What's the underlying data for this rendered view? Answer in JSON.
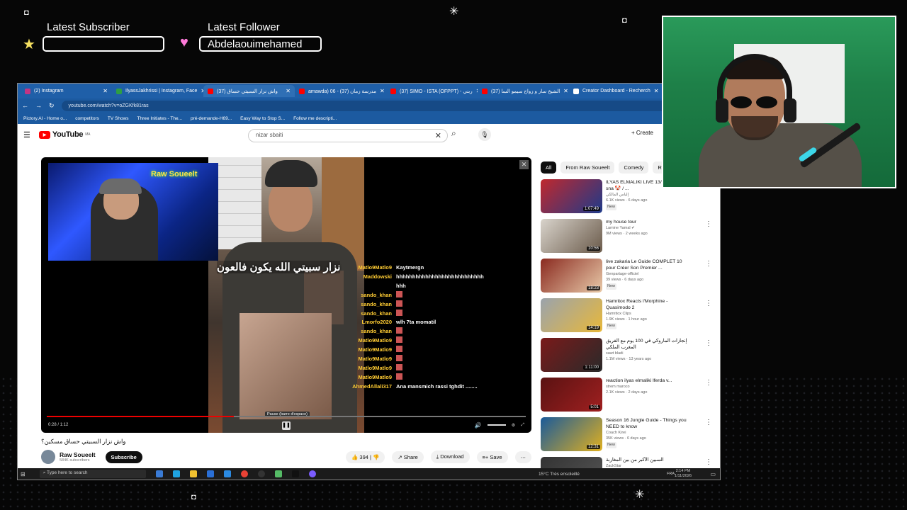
{
  "overlay": {
    "subscriber_label": "Latest Subscriber",
    "subscriber_value": "",
    "follower_label": "Latest Follower",
    "follower_value": "Abdelaouimehamed"
  },
  "browser": {
    "tabs": [
      {
        "label": "(2) Instagram",
        "color": "#c13584"
      },
      {
        "label": "IlyassJakhrissi | Instagram, Face",
        "color": "#2e9e44"
      },
      {
        "label": "واش نزار السبيتي حساق (37)",
        "color": "#ff0000"
      },
      {
        "label": "amawda) 06 - مدرسة زمان (37)",
        "color": "#ff0000"
      },
      {
        "label": "(37) SIMO - ISTA (OFPPT) - ربني",
        "color": "#ff0000"
      },
      {
        "label": "(37) الشيخ سار و زواج سيمو السا",
        "color": "#ff0000"
      },
      {
        "label": "Creator Dashboard - Recherch",
        "color": "#ffffff"
      }
    ],
    "url": "youtube.com/watch?v=oZGKfk81ras",
    "bookmarks": [
      "Pictory.AI - Home o...",
      "competitors",
      "TV Shows",
      "Three Initiates - The...",
      "pré-demande-H69...",
      "Easy Way to Stop S...",
      "Follow me descripti..."
    ]
  },
  "youtube": {
    "logo": "YouTube",
    "logo_sup": "MA",
    "search_value": "nizar sbaiti",
    "create_label": "Create",
    "video": {
      "title": "واش نزار السبيتي حساق مسكين؟",
      "arabic_caption": "نزار سبيتي الله يكون فالعون",
      "streamer_neon": "Raw Soueelt",
      "time": "0:28 / 1:12",
      "progress": 0.39,
      "tooltip": "Pause (barre d'espace)"
    },
    "chat": [
      {
        "user": "Matlo9Matlo9",
        "msg": "Kaytmergn"
      },
      {
        "user": "Maddowski",
        "msg": "hhhhhhhhhhhhhhhhhhhhhhhhhhh hhh"
      },
      {
        "user": "sando_khan",
        "msg": ""
      },
      {
        "user": "sando_khan",
        "msg": ""
      },
      {
        "user": "sando_khan",
        "msg": ""
      },
      {
        "user": "Lmorfo2020",
        "msg": "wlh 7ta momatil"
      },
      {
        "user": "sando_khan",
        "msg": ""
      },
      {
        "user": "Matlo9Matlo9",
        "msg": ""
      },
      {
        "user": "Matlo9Matlo9",
        "msg": ""
      },
      {
        "user": "Matlo9Matlo9",
        "msg": ""
      },
      {
        "user": "Matlo9Matlo9",
        "msg": ""
      },
      {
        "user": "Matlo9Matlo9",
        "msg": ""
      },
      {
        "user": "AhmedAllali317",
        "msg": "Ana mansmich rassi tghdit ........"
      }
    ],
    "channel": {
      "name": "Raw Soueelt",
      "subs": "584K subscribers",
      "subscribe": "Subscribe",
      "likes": "394",
      "share": "Share",
      "download": "Download",
      "save": "Save"
    },
    "chips": [
      "All",
      "From Raw Soueelt",
      "Comedy",
      "Relate"
    ],
    "recs": [
      {
        "title": "ILYAS ELMALIKI LIVE 13/11/2022 bla sna 🤡 / ...",
        "channel": "إلياس المالكي",
        "meta": "6.1K views · 6 days ago",
        "dur": "1:07:49",
        "new": "New",
        "c1": "#c0282d",
        "c2": "#1e3a8a"
      },
      {
        "title": "my house tour",
        "channel": "Lamine Yamal ✔",
        "meta": "9M views · 2 weeks ago",
        "dur": "10:56",
        "new": "",
        "c1": "#d9d4cc",
        "c2": "#6a5a4a"
      },
      {
        "title": "live zakaria Le Guide COMPLET 10 pour Créer Son Premier ...",
        "channel": "Genpartage-officiel",
        "meta": "39 views · 6 days ago",
        "dur": "18:23",
        "new": "New",
        "c1": "#8a2a20",
        "c2": "#e8c9a8"
      },
      {
        "title": "Hamritox Reacts l'Morphine - Quasimodo 2",
        "channel": "Hamritox Clips",
        "meta": "1.9K views · 1 hour ago",
        "dur": "14:19",
        "new": "New",
        "c1": "#9aa3ad",
        "c2": "#e8b83a"
      },
      {
        "title": "إنجازات الماروكي في 100 يوم مع الفريق المغرب الملكي",
        "channel": "sawt bladi",
        "meta": "1.1M views · 13 years ago",
        "dur": "1:11:00",
        "new": "",
        "c1": "#7a1a1a",
        "c2": "#2a2a2a"
      },
      {
        "title": "reaction ilyas elmaliki lferda v...",
        "channel": "strem maroco",
        "meta": "2.1K views · 2 days ago",
        "dur": "5:01",
        "new": "",
        "c1": "#5a1212",
        "c2": "#a02020"
      },
      {
        "title": "Season 16 Jungle Guide - Things you NEED to know",
        "channel": "Coach Kirei",
        "meta": "35K views · 6 days ago",
        "dur": "12:31",
        "new": "New",
        "c1": "#1a5a9a",
        "c2": "#e0b020"
      },
      {
        "title": "السبين الأكبر من بين المغاربة",
        "channel": "ZackStar",
        "meta": "",
        "dur": "",
        "new": "",
        "c1": "#333333",
        "c2": "#555555"
      }
    ]
  },
  "taskbar": {
    "search_placeholder": "Type here to search",
    "weather": "15°C Très ensoleillé",
    "lang": "FRA",
    "time": "2:14 PM",
    "date": "1/11/2026"
  }
}
